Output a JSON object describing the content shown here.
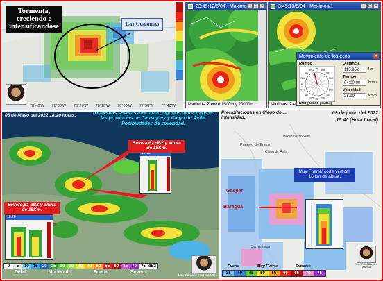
{
  "top_left": {
    "title": "Tormenta, creciendo e intensificándose",
    "callout": "Las Guásimas",
    "axis_labels": [
      "78°40'W",
      "78°30'W",
      "78°20'W",
      "78°10'W",
      "78°00'W",
      "77°50'W",
      "77°40'W"
    ]
  },
  "top_right": {
    "window1_title": "23:45:12/6/04 - Maximos/1",
    "window2_title": "3:45:13/6/04 - Maximos/1",
    "window1_status": "Maximos: Z entre 1500m y 20000m",
    "window2_status": "Maximos: Z entre",
    "dialog": {
      "title": "Movimiento de los ecos",
      "rumbo_label": "Rumbo",
      "distancia_label": "Distancia",
      "distancia_value": "115.952",
      "distancia_unit": "km",
      "tiempo_label": "Tiempo",
      "tiempo_value": "04:00:00",
      "tiempo_unit": "h:m:s",
      "velocidad_label": "Velocidad",
      "velocidad_value": "28.99",
      "velocidad_unit": "km/h",
      "direction": "NNO (346.98 grados)",
      "compass": [
        "N",
        "NNE",
        "NE",
        "ENE",
        "E",
        "ESE",
        "SE",
        "SSE",
        "S",
        "SSO",
        "SO",
        "OSO",
        "O",
        "ONO",
        "NO",
        "NNO"
      ]
    }
  },
  "bottom_left": {
    "date": "03 de Mayo del 2022 18:20 horas.",
    "headline": "Tormentas severas afectando algunos municipios en las provincias de Camagüey y Ciego de Ávila. Posibilidades de severidad.",
    "annot1": "Severa,61 dBZ y altura de 18Km.",
    "annot2": "Severo,61 dBZ y altura de 15Km.",
    "inset1_title": "19:15",
    "inset2_title": "18:20",
    "cbar_values": [
      "0",
      "5",
      "10",
      "15",
      "20",
      "25",
      "30",
      "35",
      "40",
      "45",
      "50",
      "55",
      "60",
      "65",
      "70",
      "75",
      "dBz"
    ],
    "cbar_categories": [
      "Débil",
      "Moderado",
      "Fuerte",
      "Severo"
    ],
    "credit": "Lic. Yaimarie Herrera Mtez."
  },
  "bottom_right": {
    "header_left": "Precipitaciones en Ciego de ... intensidad.",
    "date": "09 de junio del 2022",
    "time": "15:40 (Hora Local)",
    "places": [
      "Primero de Enero",
      "Ciego de Ávila",
      "Pedro Betancourt",
      "Gaspar",
      "Baraguá",
      "San Antonio"
    ],
    "annot": "Muy Fuerte/ corte vertical, 16 km de altura.",
    "legend_categories": [
      "Fuerte",
      "Muy Fuerte",
      "Extremo"
    ],
    "legend_values": [
      "35",
      "40",
      "45",
      "50",
      "55",
      "60",
      "65",
      "70",
      "75"
    ],
    "credit": "Ms. Ysbel Alayón Alonso"
  },
  "colors": {
    "frame": "#d81818",
    "title_bar": "#2d63c9",
    "annotation_box": "#e02020",
    "headline_text": "#3fe0ff"
  }
}
